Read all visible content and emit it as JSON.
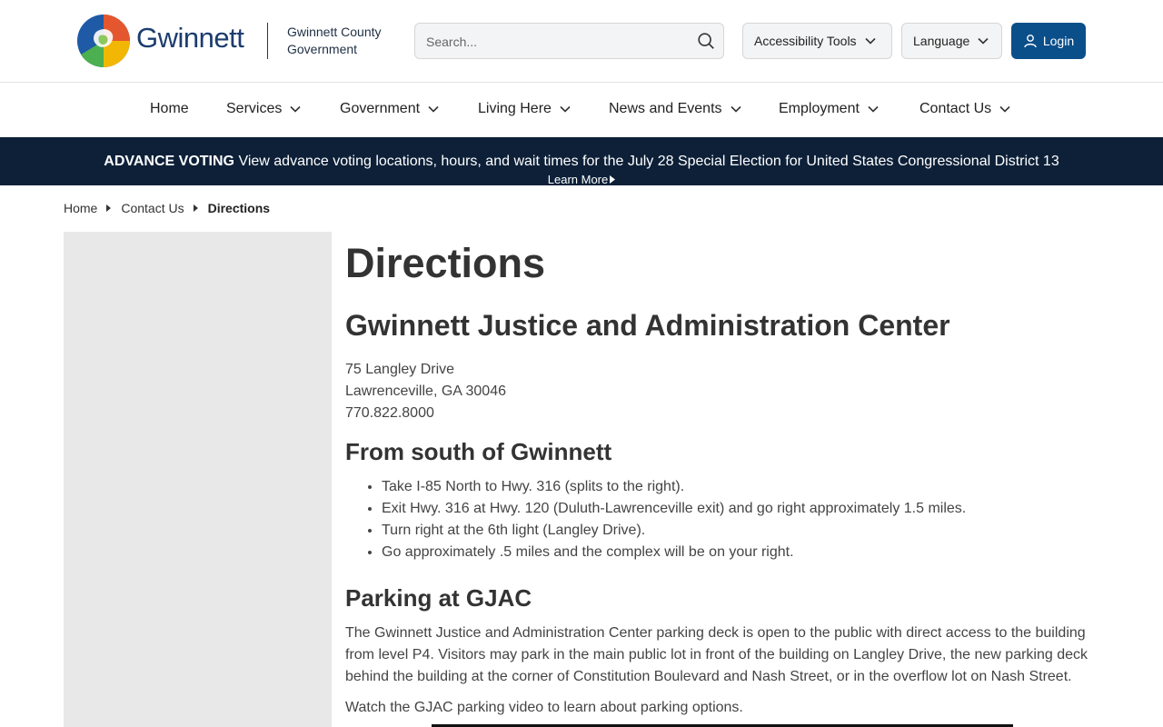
{
  "header": {
    "brand": "Gwinnett",
    "brand_sub_line1": "Gwinnett County",
    "brand_sub_line2": "Government",
    "search_placeholder": "Search...",
    "accessibility_label": "Accessibility Tools",
    "language_label": "Language",
    "login_label": "Login",
    "logo_colors": [
      "#1f5aa6",
      "#e4572e",
      "#f2b705",
      "#4caf50"
    ],
    "accent_color": "#0b4f8a"
  },
  "nav": {
    "items": [
      {
        "label": "Home"
      },
      {
        "label": "Services"
      },
      {
        "label": "Government"
      },
      {
        "label": "Living Here"
      },
      {
        "label": "News and Events"
      },
      {
        "label": "Employment"
      },
      {
        "label": "Contact Us"
      }
    ]
  },
  "alert": {
    "strong": "ADVANCE VOTING",
    "text": "View advance voting locations, hours, and wait times for the July 28 Special Election for United States Congressional District 13",
    "more": "Learn More"
  },
  "breadcrumb": {
    "items": [
      "Home",
      "Contact Us",
      "Directions"
    ]
  },
  "page": {
    "title": "Directions",
    "center_title": "Gwinnett Justice and Administration Center",
    "address_line1": "75 Langley Drive",
    "address_line2": "Lawrenceville, GA 30046",
    "phone": "770.822.8000",
    "south_title": "From south of Gwinnett",
    "south_steps": [
      "Take I-85 North to Hwy. 316 (splits to the right).",
      "Exit Hwy. 316 at Hwy. 120 (Duluth-Lawrenceville exit) and go right approximately 1.5 miles.",
      "Turn right at the 6th light (Langley Drive).",
      "Go approximately .5 miles and the complex will be on your right."
    ],
    "parking_title": "Parking at GJAC",
    "parking_text": "The Gwinnett Justice and Administration Center parking deck is open to the public with direct access to the building from level P4. Visitors may park in the main public lot in front of the building on Langley Drive, the new parking deck behind the building at the corner of Constitution Boulevard and Nash Street, or in the overflow lot on Nash Street.",
    "video_text": "Watch the GJAC parking video to learn about parking options."
  }
}
